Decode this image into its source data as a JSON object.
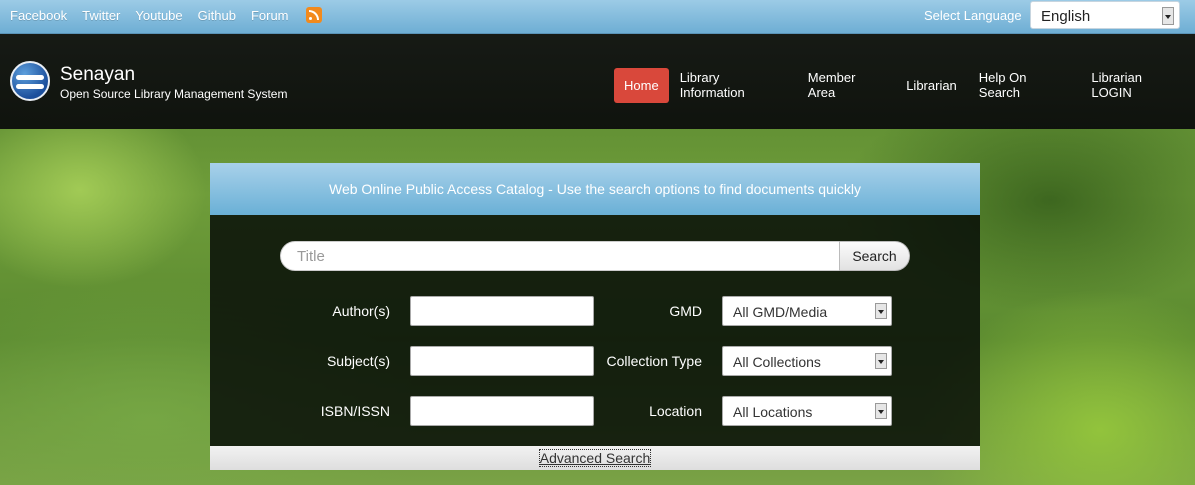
{
  "topbar": {
    "social_links": [
      "Facebook",
      "Twitter",
      "Youtube",
      "Github",
      "Forum"
    ],
    "rss_icon": "rss-icon",
    "select_language_label": "Select Language",
    "language_value": "English"
  },
  "header": {
    "site_name": "Senayan",
    "site_subtitle": "Open Source Library Management System",
    "nav": [
      "Home",
      "Library Information",
      "Member Area",
      "Librarian",
      "Help On Search",
      "Librarian LOGIN"
    ],
    "active_nav": "Home",
    "active_color": "#d9483b"
  },
  "search_panel": {
    "heading": "Web Online Public Access Catalog - Use the search options to find documents quickly",
    "search_placeholder": "Title",
    "search_button": "Search",
    "fields": {
      "author_label": "Author(s)",
      "subject_label": "Subject(s)",
      "isbn_label": "ISBN/ISSN",
      "gmd_label": "GMD",
      "gmd_value": "All GMD/Media",
      "collection_label": "Collection Type",
      "collection_value": "All Collections",
      "location_label": "Location",
      "location_value": "All Locations"
    },
    "advanced_search": "Advanced Search"
  }
}
